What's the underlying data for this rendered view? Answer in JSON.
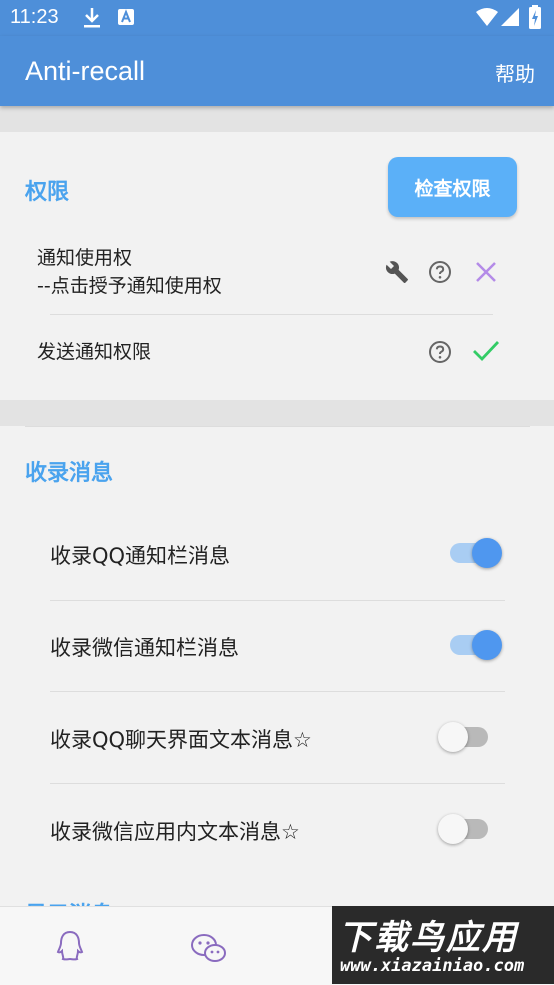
{
  "status_bar": {
    "time": "11:23"
  },
  "app_bar": {
    "title": "Anti-recall",
    "help_label": "帮助"
  },
  "permissions": {
    "section_title": "权限",
    "check_button_label": "检查权限",
    "items": [
      {
        "label_line1": "通知使用权",
        "label_line2": "--点击授予通知使用权",
        "state": "not-granted",
        "state_color": "#b48be8"
      },
      {
        "label_line1": "发送通知权限",
        "state": "granted",
        "state_color": "#33cc66"
      }
    ]
  },
  "record_messages": {
    "section_title": "收录消息",
    "toggles": [
      {
        "label": "收录QQ通知栏消息",
        "on": true
      },
      {
        "label": "收录微信通知栏消息",
        "on": true
      },
      {
        "label": "收录QQ聊天界面文本消息☆",
        "on": false
      },
      {
        "label": "收录微信应用内文本消息☆",
        "on": false
      }
    ]
  },
  "next_section_title": "显示消息",
  "bottom_nav": {
    "items": [
      "qq-icon",
      "wechat-icon"
    ]
  },
  "watermark": {
    "main": "下载鸟应用",
    "url": "www.xiazainiao.com"
  },
  "colors": {
    "primary": "#4e8fd9",
    "accent": "#4aa3ee",
    "switch_on": "#4f97ef"
  }
}
